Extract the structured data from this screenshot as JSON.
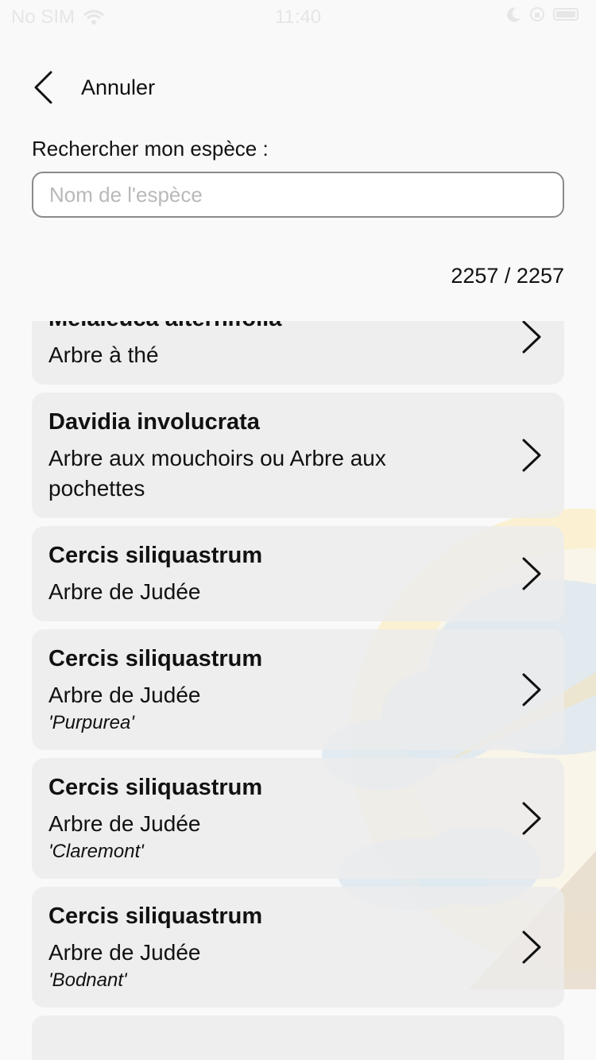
{
  "status_bar": {
    "carrier": "No SIM",
    "time": "11:40"
  },
  "header": {
    "back_label": "Annuler"
  },
  "search": {
    "label": "Rechercher mon espèce :",
    "placeholder": "Nom de l'espèce",
    "value": ""
  },
  "result_count": "2257 / 2257",
  "species": [
    {
      "latin": "Melaleuca alternifolia",
      "common": "Arbre à thé",
      "cultivar": ""
    },
    {
      "latin": "Davidia involucrata",
      "common": "Arbre aux mouchoirs ou Arbre aux pochettes",
      "cultivar": ""
    },
    {
      "latin": "Cercis siliquastrum",
      "common": "Arbre de Judée",
      "cultivar": ""
    },
    {
      "latin": "Cercis siliquastrum",
      "common": "Arbre de Judée",
      "cultivar": "'Purpurea'"
    },
    {
      "latin": "Cercis siliquastrum",
      "common": "Arbre de Judée",
      "cultivar": "'Claremont'"
    },
    {
      "latin": "Cercis siliquastrum",
      "common": "Arbre de Judée",
      "cultivar": "'Bodnant'"
    }
  ],
  "colors": {
    "card_bg": "#ececec",
    "input_border": "#8a8a8a",
    "placeholder": "#b9b9b9"
  }
}
